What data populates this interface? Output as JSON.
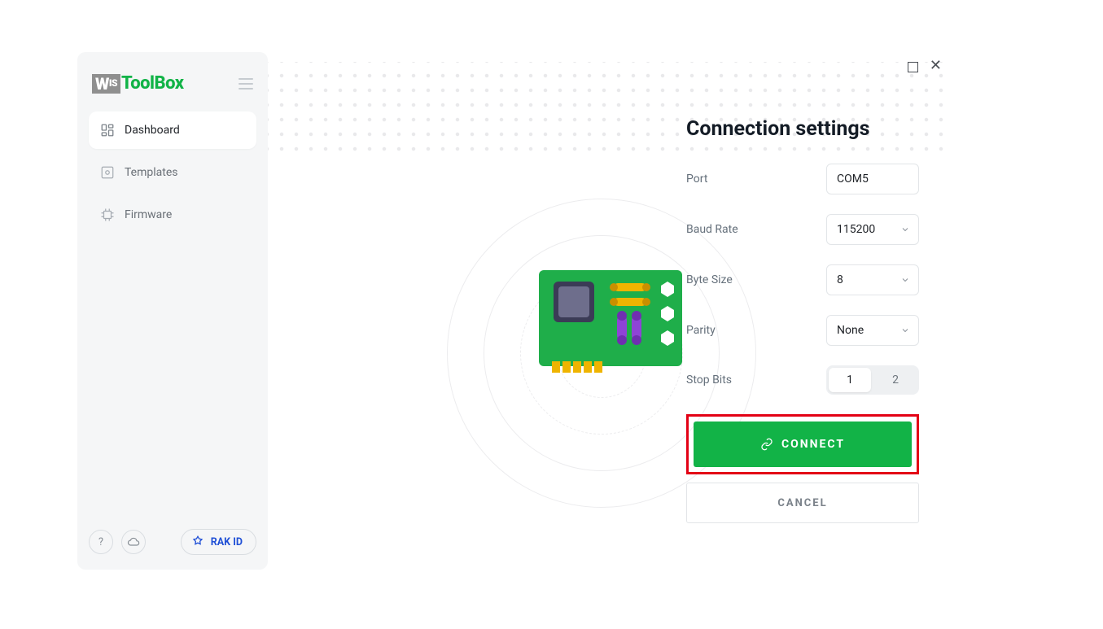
{
  "logo": {
    "wis": "WIS",
    "toolbox": "ToolBox"
  },
  "sidebar": {
    "items": [
      {
        "label": "Dashboard"
      },
      {
        "label": "Templates"
      },
      {
        "label": "Firmware"
      }
    ],
    "rak_id_label": "RAK ID"
  },
  "panel": {
    "title": "Connection settings",
    "port_label": "Port",
    "port_value": "COM5",
    "baud_label": "Baud Rate",
    "baud_value": "115200",
    "bytesize_label": "Byte Size",
    "bytesize_value": "8",
    "parity_label": "Parity",
    "parity_value": "None",
    "stopbits_label": "Stop Bits",
    "stopbits_options": [
      "1",
      "2"
    ],
    "stopbits_selected": "1",
    "connect_label": "CONNECT",
    "cancel_label": "CANCEL"
  }
}
